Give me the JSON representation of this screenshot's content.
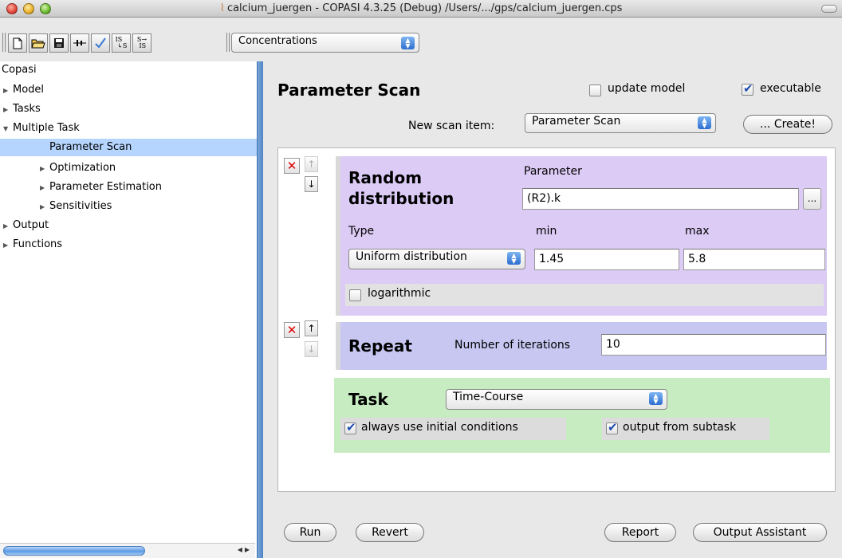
{
  "window": {
    "title": "calcium_juergen - COPASI 4.3.25 (Debug) /Users/.../gps/calcium_juergen.cps"
  },
  "toolbar": {
    "buttons": [
      {
        "name": "new-file-icon",
        "glyph": "🗋"
      },
      {
        "name": "open-folder-icon",
        "glyph": "📂"
      },
      {
        "name": "save-disk-icon",
        "glyph": "💾"
      },
      {
        "name": "slider-icon",
        "glyph": "⊸"
      },
      {
        "name": "check-icon",
        "glyph": "✓"
      },
      {
        "name": "is-to-s-icon",
        "glyph": "IS ↳S"
      },
      {
        "name": "s-to-is-icon",
        "glyph": "S ↳IS"
      }
    ],
    "mode_select": "Concentrations"
  },
  "tree": {
    "root": "Copasi",
    "items": [
      {
        "label": "Model",
        "arrow": "▶"
      },
      {
        "label": "Tasks",
        "arrow": "▶"
      },
      {
        "label": "Multiple Task",
        "arrow": "▼"
      },
      {
        "label": "Parameter Scan",
        "arrow": "",
        "selected": true
      },
      {
        "label": "Optimization",
        "arrow": "▶"
      },
      {
        "label": "Parameter Estimation",
        "arrow": "▶"
      },
      {
        "label": "Sensitivities",
        "arrow": "▶"
      },
      {
        "label": "Output",
        "arrow": "▶"
      },
      {
        "label": "Functions",
        "arrow": "▶"
      }
    ]
  },
  "main": {
    "title": "Parameter Scan",
    "update_model_label": "update model",
    "update_model_checked": false,
    "executable_label": "executable",
    "executable_checked": true,
    "new_scan_item_label": "New scan item:",
    "new_scan_item_value": "Parameter Scan",
    "create_button": "... Create!"
  },
  "random": {
    "heading_line1": "Random",
    "heading_line2": "distribution",
    "parameter_label": "Parameter",
    "parameter_value": "(R2).k",
    "browse_button": "...",
    "type_label": "Type",
    "type_value": "Uniform distribution",
    "min_label": "min",
    "min_value": "1.45",
    "max_label": "max",
    "max_value": "5.8",
    "logarithmic_label": "logarithmic",
    "logarithmic_checked": false
  },
  "repeat": {
    "heading": "Repeat",
    "iterations_label": "Number of iterations",
    "iterations_value": "10"
  },
  "task": {
    "heading": "Task",
    "task_value": "Time-Course",
    "initial_conditions_label": "always use initial conditions",
    "initial_conditions_checked": true,
    "output_subtask_label": "output from subtask",
    "output_subtask_checked": true
  },
  "buttons": {
    "run": "Run",
    "revert": "Revert",
    "report": "Report",
    "output_assistant": "Output Assistant"
  },
  "colors": {
    "random_box": "#dccbf5",
    "repeat_box": "#c7c7f2",
    "task_box": "#c7ecc1",
    "selection": "#b5d5ff",
    "delete_x": "#dd0000"
  }
}
